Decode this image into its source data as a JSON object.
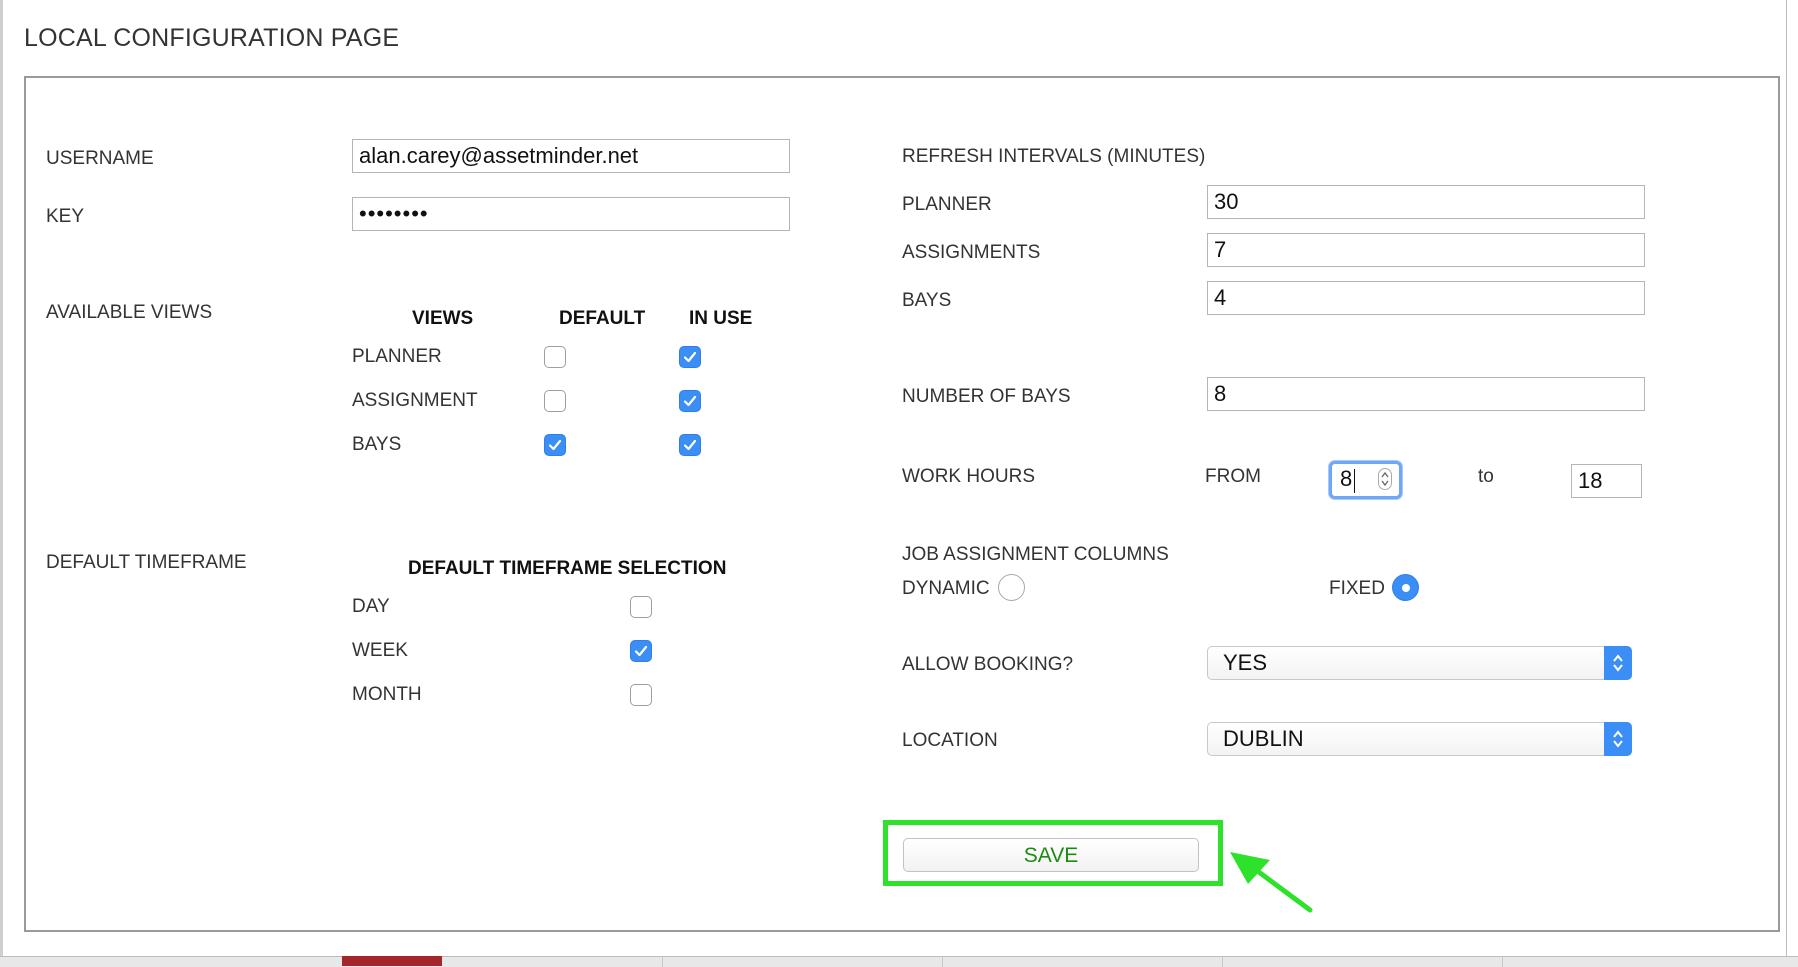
{
  "page": {
    "title": "LOCAL CONFIGURATION PAGE"
  },
  "credentials": {
    "username_label": "USERNAME",
    "username_value": "alan.carey@assetminder.net",
    "key_label": "KEY",
    "key_value": "********"
  },
  "views": {
    "section_label": "AVAILABLE VIEWS",
    "headers": {
      "views": "VIEWS",
      "default": "DEFAULT",
      "in_use": "IN USE"
    },
    "rows": [
      {
        "label": "PLANNER",
        "default": false,
        "in_use": true
      },
      {
        "label": "ASSIGNMENT",
        "default": false,
        "in_use": true
      },
      {
        "label": "BAYS",
        "default": true,
        "in_use": true
      }
    ]
  },
  "timeframe": {
    "section_label": "DEFAULT TIMEFRAME",
    "header": "DEFAULT TIMEFRAME SELECTION",
    "rows": [
      {
        "label": "DAY",
        "checked": false
      },
      {
        "label": "WEEK",
        "checked": true
      },
      {
        "label": "MONTH",
        "checked": false
      }
    ]
  },
  "refresh": {
    "section_label": "REFRESH INTERVALS (MINUTES)",
    "planner_label": "PLANNER",
    "planner_value": "30",
    "assignments_label": "ASSIGNMENTS",
    "assignments_value": "7",
    "bays_label": "BAYS",
    "bays_value": "4"
  },
  "bays": {
    "label": "NUMBER OF BAYS",
    "value": "8"
  },
  "work_hours": {
    "label": "WORK HOURS",
    "from_label": "FROM",
    "from_value": "8",
    "to_label": "to",
    "to_value": "18"
  },
  "job_columns": {
    "label": "JOB ASSIGNMENT COLUMNS",
    "dynamic_label": "DYNAMIC",
    "dynamic_selected": false,
    "fixed_label": "FIXED",
    "fixed_selected": true
  },
  "booking": {
    "label": "ALLOW BOOKING?",
    "value": "YES"
  },
  "location": {
    "label": "LOCATION",
    "value": "DUBLIN"
  },
  "save": {
    "label": "SAVE"
  },
  "colors": {
    "accent": "#3a8ef6",
    "highlight": "#2ee22b",
    "save_text": "#1d8a12"
  }
}
